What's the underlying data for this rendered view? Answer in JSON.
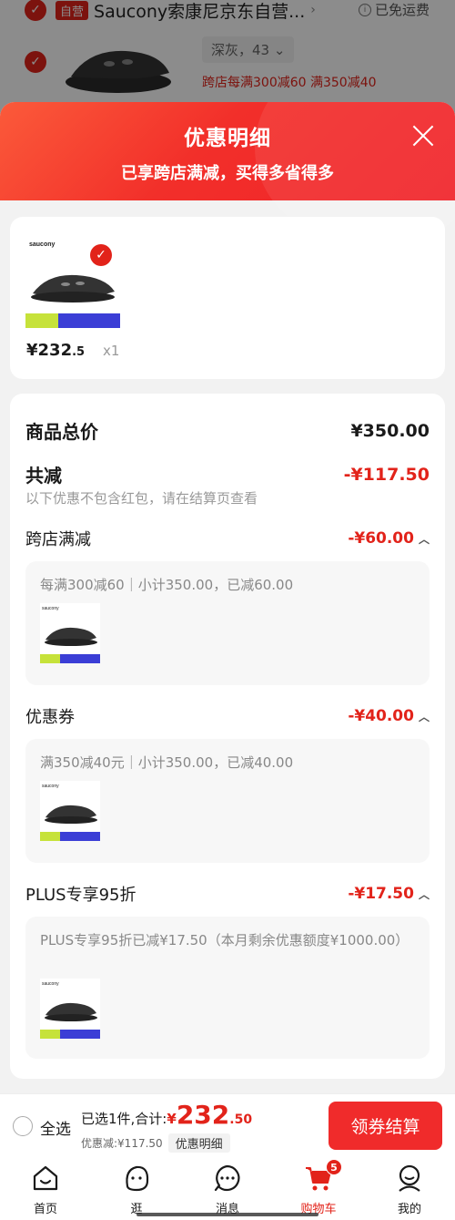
{
  "background": {
    "shop_tag": "自营",
    "shop_name": "Saucony索康尼京东自营...",
    "shipping": "已免运费",
    "sku": "深灰，43",
    "promo": "跨店每满300减60  满350减40"
  },
  "modal": {
    "title": "优惠明细",
    "subtitle": "已享跨店满减，买得多省得多",
    "product": {
      "brand": "saucony",
      "price_int": "¥232",
      "price_dec": ".5",
      "qty": "x1"
    },
    "total_label": "商品总价",
    "total_value": "¥350.00",
    "reduce_label": "共减",
    "reduce_value": "-¥117.50",
    "note": "以下优惠不包含红包，请在结算页查看",
    "sections": [
      {
        "label": "跨店满减",
        "value": "-¥60.00",
        "desc": "每满300减60｜小计350.00，已减60.00"
      },
      {
        "label": "优惠券",
        "value": "-¥40.00",
        "desc": "满350减40元｜小计350.00，已减40.00"
      },
      {
        "label": "PLUS专享95折",
        "value": "-¥17.50",
        "desc": "PLUS专享95折已减¥17.50（本月剩余优惠额度¥1000.00）"
      }
    ]
  },
  "bottom": {
    "select_all": "全选",
    "sum_label": "已选1件,合计:",
    "sum_yen": "¥",
    "sum_int": "232",
    "sum_dec": ".50",
    "discount": "优惠减:¥117.50",
    "detail": "优惠明细",
    "checkout": "领券结算"
  },
  "tabs": [
    {
      "label": "首页",
      "icon": "home-icon"
    },
    {
      "label": "逛",
      "icon": "stroll-icon"
    },
    {
      "label": "消息",
      "icon": "message-icon"
    },
    {
      "label": "购物车",
      "icon": "cart-icon",
      "badge": "5"
    },
    {
      "label": "我的",
      "icon": "profile-icon"
    }
  ],
  "colors": {
    "accent": "#e2231a",
    "header_gradient_start": "#fb5a3a",
    "header_gradient_end": "#f0232a"
  }
}
